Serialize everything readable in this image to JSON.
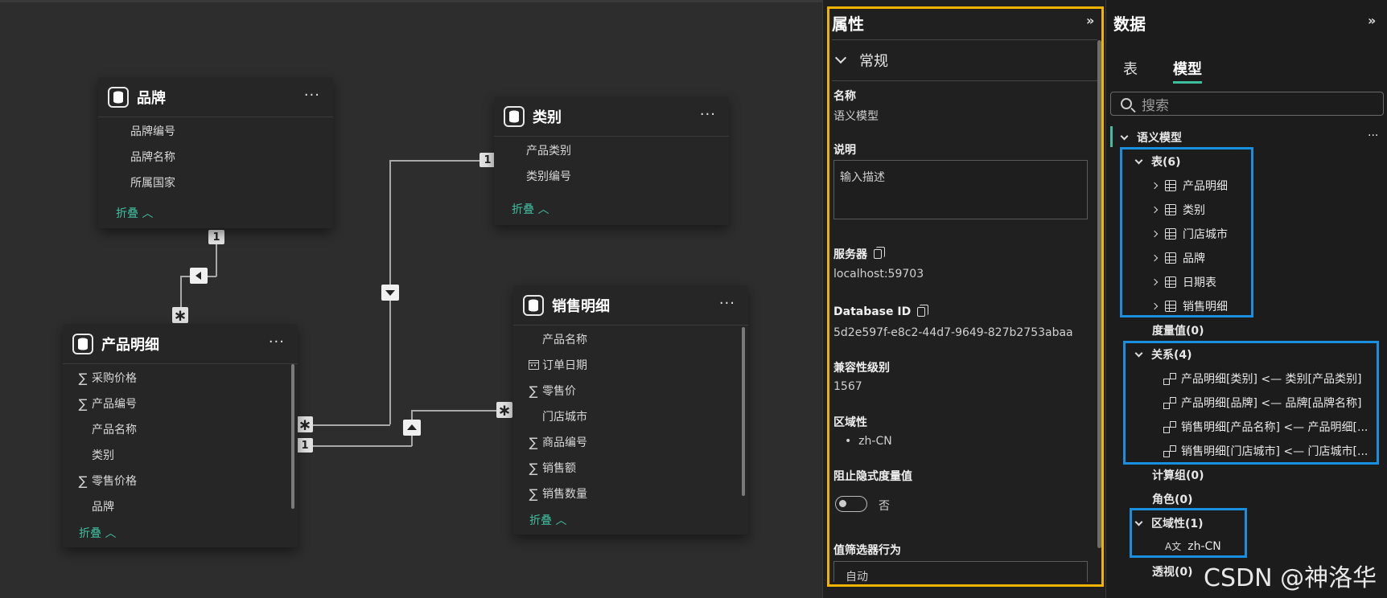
{
  "model": {
    "tables": [
      {
        "title": "品牌",
        "fields": [
          "品牌编号",
          "品牌名称",
          "所属国家"
        ],
        "collapse": "折叠 ︿"
      },
      {
        "title": "类别",
        "fields": [
          "产品类别",
          "类别编号"
        ],
        "collapse": "折叠 ︿"
      },
      {
        "title": "产品明细",
        "fields": [
          {
            "icon": "∑",
            "name": "采购价格"
          },
          {
            "icon": "∑",
            "name": "产品编号"
          },
          {
            "icon": "",
            "name": "产品名称"
          },
          {
            "icon": "",
            "name": "类别"
          },
          {
            "icon": "∑",
            "name": "零售价格"
          },
          {
            "icon": "",
            "name": "品牌"
          }
        ],
        "collapse": "折叠 ︿"
      },
      {
        "title": "销售明细",
        "fields": [
          {
            "icon": "",
            "name": "产品名称"
          },
          {
            "icon": "calendar",
            "name": "订单日期"
          },
          {
            "icon": "∑",
            "name": "零售价"
          },
          {
            "icon": "",
            "name": "门店城市"
          },
          {
            "icon": "∑",
            "name": "商品编号"
          },
          {
            "icon": "∑",
            "name": "销售额"
          },
          {
            "icon": "∑",
            "name": "销售数量"
          }
        ],
        "collapse": "折叠 ︿"
      }
    ],
    "more": "···",
    "badges": {
      "one": "1",
      "many": "∗"
    }
  },
  "properties": {
    "title": "属性",
    "expand": "»",
    "section": "常规",
    "name_label": "名称",
    "name_value": "语义模型",
    "desc_label": "说明",
    "desc_placeholder": "输入描述",
    "server_label": "服务器",
    "server_value": "localhost:59703",
    "dbid_label": "Database ID",
    "dbid_value": "5d2e597f-e8c2-44d7-9649-827b2753abaa",
    "compat_label": "兼容性级别",
    "compat_value": "1567",
    "culture_label": "区域性",
    "culture_value": "zh-CN",
    "implicit_label": "阻止隐式度量值",
    "implicit_value": "否",
    "filter_label": "值筛选器行为",
    "filter_value": "自动"
  },
  "data_pane": {
    "title": "数据",
    "expand": "»",
    "tabs": [
      "表",
      "模型"
    ],
    "search_placeholder": "搜索",
    "root": "语义模型",
    "root_more": "···",
    "tables_group": "表(6)",
    "tables": [
      "产品明细",
      "类别",
      "门店城市",
      "品牌",
      "日期表",
      "销售明细"
    ],
    "measures": "度量值(0)",
    "relations_group": "关系(4)",
    "relations": [
      "产品明细[类别] <— 类别[产品类别]",
      "产品明细[品牌] <— 品牌[品牌名称]",
      "销售明细[产品名称] <— 产品明细[...",
      "销售明细[门店城市] <— 门店城市[..."
    ],
    "calc_groups": "计算组(0)",
    "roles": "角色(0)",
    "cultures_group": "区域性(1)",
    "cultures": [
      "zh-CN"
    ],
    "perspectives": "透视(0)"
  },
  "watermark": "CSDN @神洛华",
  "colors": {
    "accent": "#3fbf9f",
    "highlight_yellow": "#f0b400",
    "highlight_blue": "#1a8fe0"
  }
}
